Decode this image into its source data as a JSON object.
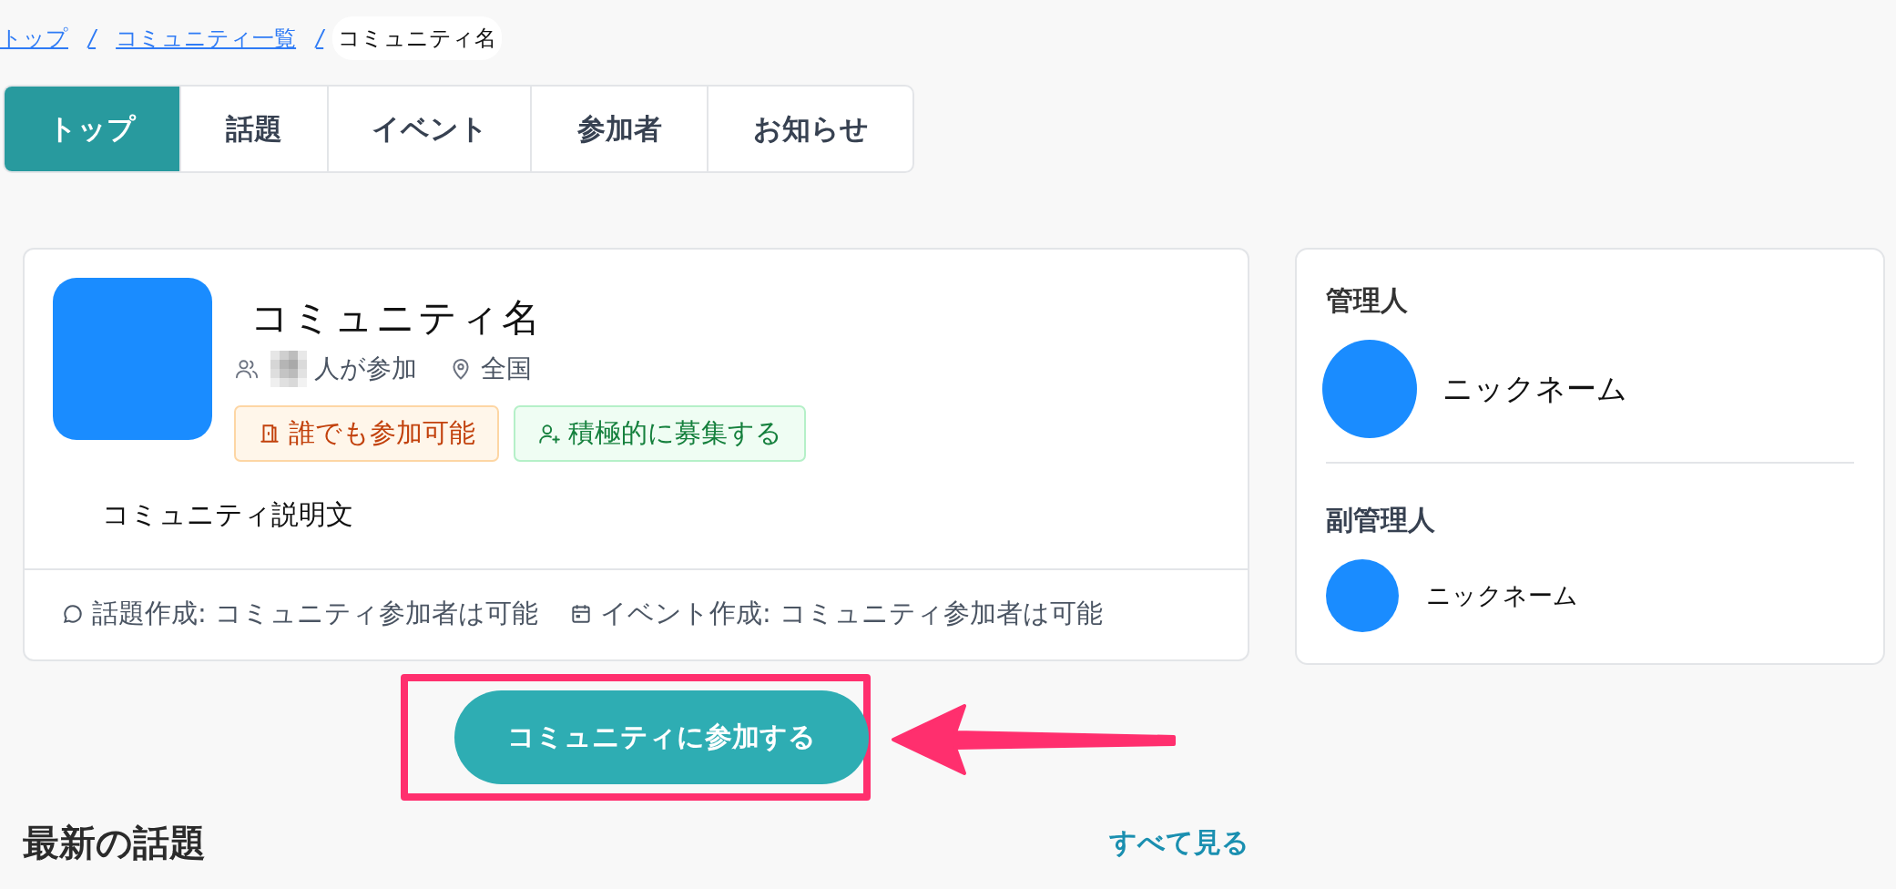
{
  "breadcrumb": [
    {
      "kind": "link",
      "label": "トップ"
    },
    {
      "kind": "separator",
      "label": "/"
    },
    {
      "kind": "link",
      "label": "コミュニティ一覧"
    },
    {
      "kind": "separator",
      "label": "/"
    },
    {
      "kind": "current",
      "label": "コミュニティ名"
    }
  ],
  "tabs": [
    {
      "label": "トップ",
      "selected": true
    },
    {
      "label": "話題",
      "selected": false
    },
    {
      "label": "イベント",
      "selected": false
    },
    {
      "label": "参加者",
      "selected": false
    },
    {
      "label": "お知らせ",
      "selected": false
    }
  ],
  "community": {
    "name": "コミュニティ名",
    "member_suffix": "人が参加",
    "location": "全国",
    "badges": [
      {
        "kind": "open",
        "label": "誰でも参加可能"
      },
      {
        "kind": "recruit",
        "label": "積極的に募集する"
      }
    ],
    "description": "コミュニティ説明文",
    "permissions": [
      {
        "kind": "topic",
        "text": "話題作成: コミュニティ参加者は可能"
      },
      {
        "kind": "event",
        "text": "イベント作成: コミュニティ参加者は可能"
      }
    ]
  },
  "join_button": {
    "label": "コミュニティに参加する"
  },
  "annotation": {
    "kind": "highlight-arrow"
  },
  "latest_topics": {
    "title": "最新の話題",
    "see_all": "すべて見る"
  },
  "staff": [
    {
      "kind": "owner",
      "role": "管理人",
      "name": "ニックネーム"
    },
    {
      "kind": "sub",
      "role": "副管理人",
      "name": "ニックネーム"
    }
  ]
}
